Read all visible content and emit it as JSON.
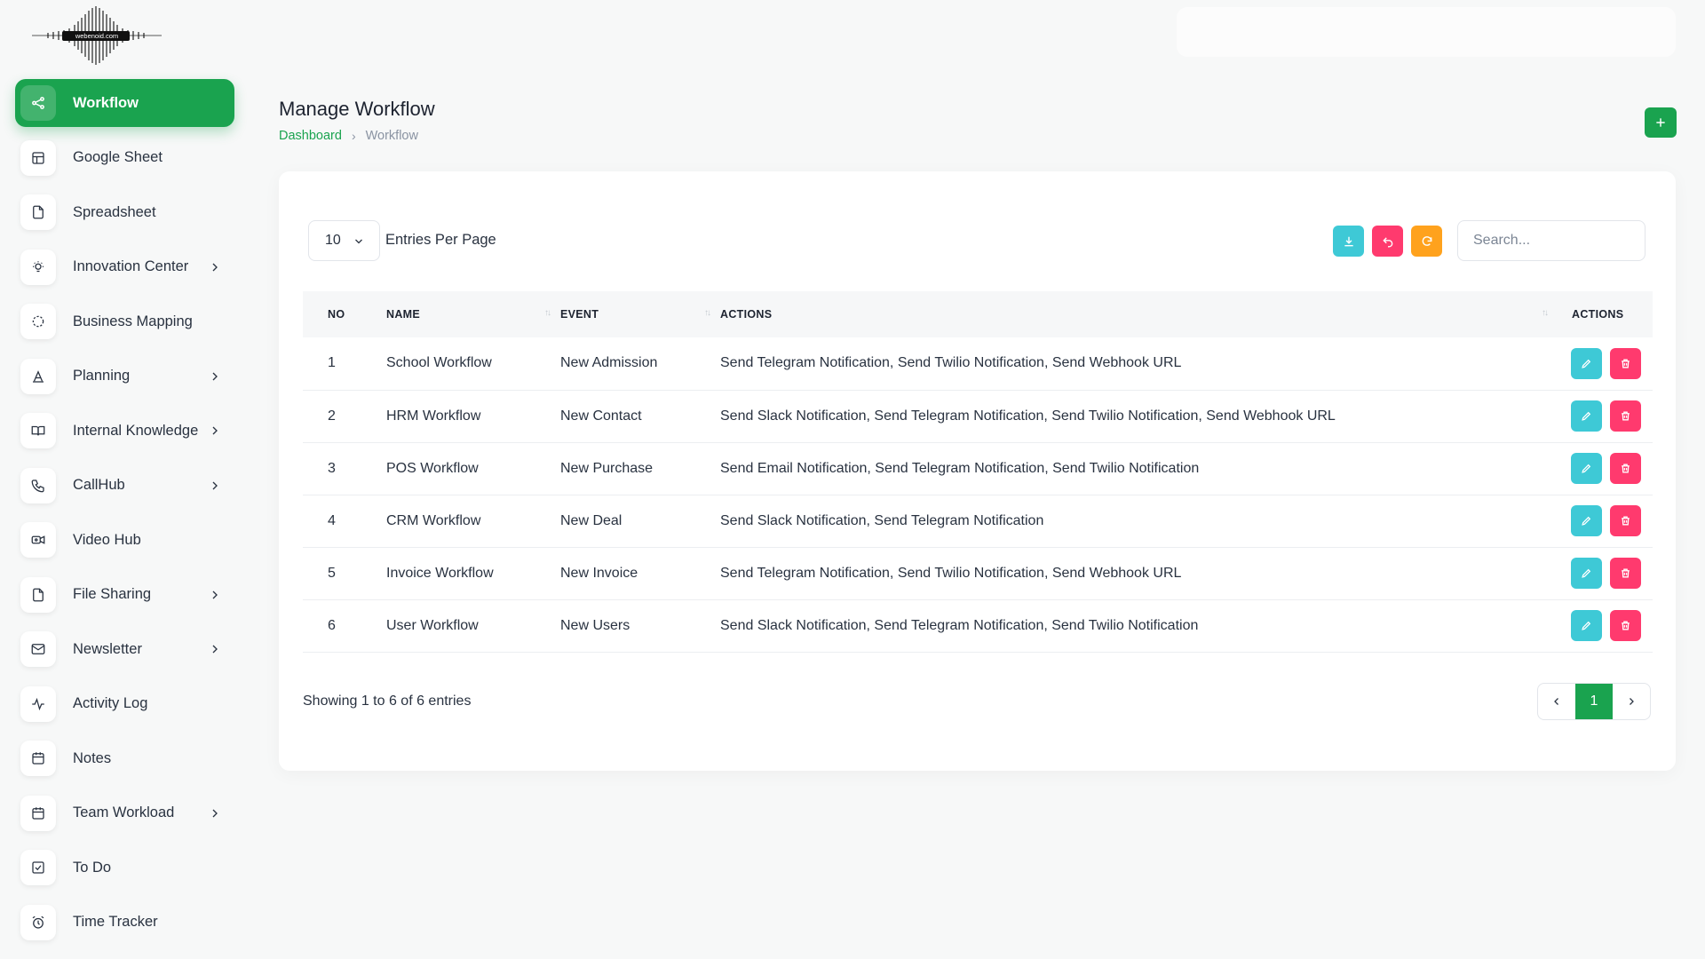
{
  "logo_text": "webenoid.com",
  "sidebar": {
    "items": [
      {
        "label": "Workflow",
        "icon": "share-icon",
        "active": true,
        "has_submenu": false
      },
      {
        "label": "Google Sheet",
        "icon": "table-icon",
        "has_submenu": false
      },
      {
        "label": "Spreadsheet",
        "icon": "file-icon",
        "has_submenu": false
      },
      {
        "label": "Innovation Center",
        "icon": "bulb-icon",
        "has_submenu": true
      },
      {
        "label": "Business Mapping",
        "icon": "circle-dashed-icon",
        "has_submenu": false
      },
      {
        "label": "Planning",
        "icon": "letter-a-icon",
        "has_submenu": true
      },
      {
        "label": "Internal Knowledge",
        "icon": "book-icon",
        "has_submenu": true
      },
      {
        "label": "CallHub",
        "icon": "phone-icon",
        "has_submenu": true
      },
      {
        "label": "Video Hub",
        "icon": "video-icon",
        "has_submenu": false
      },
      {
        "label": "File Sharing",
        "icon": "file-icon",
        "has_submenu": true
      },
      {
        "label": "Newsletter",
        "icon": "mail-icon",
        "has_submenu": true
      },
      {
        "label": "Activity Log",
        "icon": "activity-icon",
        "has_submenu": false
      },
      {
        "label": "Notes",
        "icon": "calendar-icon",
        "has_submenu": false
      },
      {
        "label": "Team Workload",
        "icon": "calendar-icon",
        "has_submenu": true
      },
      {
        "label": "To Do",
        "icon": "checkbox-icon",
        "has_submenu": false
      },
      {
        "label": "Time Tracker",
        "icon": "alarm-icon",
        "has_submenu": false
      }
    ]
  },
  "header": {
    "title": "Manage Workflow",
    "breadcrumb": {
      "link": "Dashboard",
      "separator": "›",
      "current": "Workflow"
    }
  },
  "toolbar": {
    "per_page_value": "10",
    "per_page_label": "Entries Per Page",
    "search_placeholder": "Search..."
  },
  "table": {
    "columns": [
      "NO",
      "NAME",
      "EVENT",
      "ACTIONS",
      "ACTIONS"
    ],
    "rows": [
      {
        "no": "1",
        "name": "School Workflow",
        "event": "New Admission",
        "actions": "Send Telegram Notification, Send Twilio Notification, Send Webhook URL"
      },
      {
        "no": "2",
        "name": "HRM Workflow",
        "event": "New Contact",
        "actions": "Send Slack Notification, Send Telegram Notification, Send Twilio Notification, Send Webhook URL"
      },
      {
        "no": "3",
        "name": "POS Workflow",
        "event": "New Purchase",
        "actions": "Send Email Notification, Send Telegram Notification, Send Twilio Notification"
      },
      {
        "no": "4",
        "name": "CRM Workflow",
        "event": "New Deal",
        "actions": "Send Slack Notification, Send Telegram Notification"
      },
      {
        "no": "5",
        "name": "Invoice Workflow",
        "event": "New Invoice",
        "actions": "Send Telegram Notification, Send Twilio Notification, Send Webhook URL"
      },
      {
        "no": "6",
        "name": "User Workflow",
        "event": "New Users",
        "actions": "Send Slack Notification, Send Telegram Notification, Send Twilio Notification"
      }
    ]
  },
  "footer": {
    "showing": "Showing 1 to 6 of 6 entries",
    "current_page": "1"
  },
  "colors": {
    "primary": "#1aa34f",
    "info": "#3ec9d6",
    "danger": "#ff3a6e",
    "warning": "#ffa21d"
  }
}
